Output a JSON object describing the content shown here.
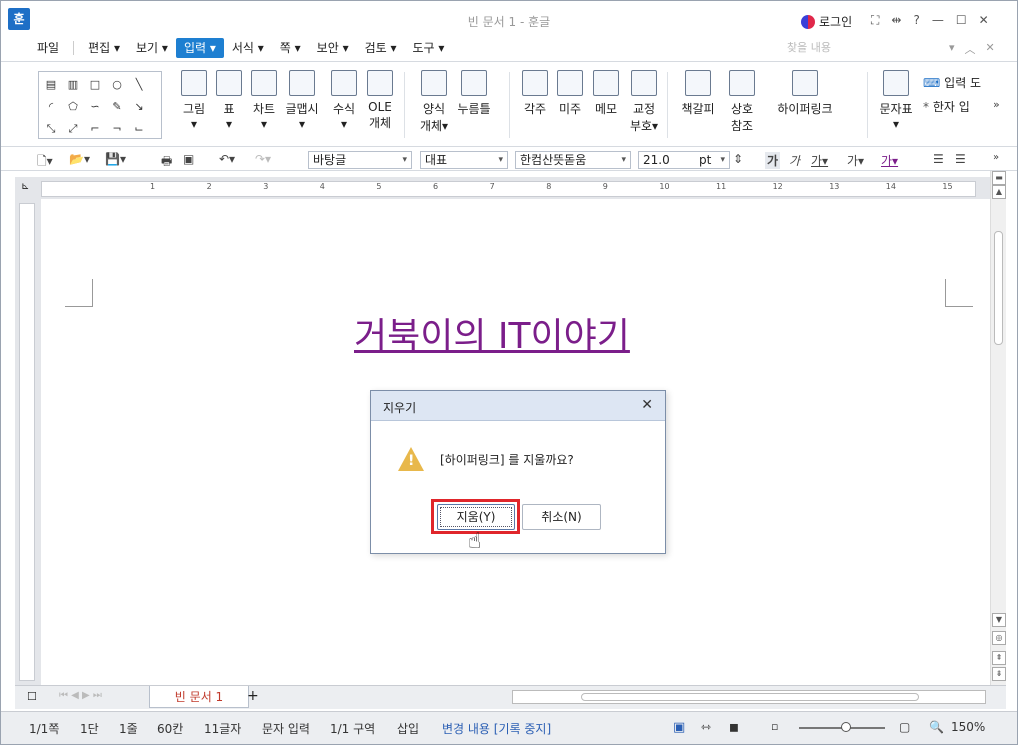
{
  "window": {
    "app_icon": "훈",
    "title": "빈 문서 1 - 훈글",
    "login": "로그인",
    "title_icons": [
      "fullscreen-icon",
      "resize-icon",
      "help-icon",
      "minimize-icon",
      "maximize-icon",
      "close-icon"
    ],
    "title_icon_glyphs": [
      "⛶",
      "⇹",
      "?",
      "—",
      "☐",
      "✕"
    ]
  },
  "menu": {
    "items": [
      {
        "label": "파일",
        "active": false
      },
      {
        "label": "편집 ▾",
        "active": false
      },
      {
        "label": "보기 ▾",
        "active": false
      },
      {
        "label": "입력 ▾",
        "active": true
      },
      {
        "label": "서식 ▾",
        "active": false
      },
      {
        "label": "쪽 ▾",
        "active": false
      },
      {
        "label": "보안 ▾",
        "active": false
      },
      {
        "label": "검토 ▾",
        "active": false
      },
      {
        "label": "도구 ▾",
        "active": false
      }
    ],
    "find_placeholder": "찾을 내용"
  },
  "ribbon": {
    "buttons": [
      {
        "label": "그림",
        "sub": "▾"
      },
      {
        "label": "표",
        "sub": "▾"
      },
      {
        "label": "차트",
        "sub": "▾"
      },
      {
        "label": "글맵시",
        "sub": "▾"
      },
      {
        "label": "수식",
        "sub": "▾"
      },
      {
        "label": "OLE",
        "sub": "개체"
      },
      {
        "label": "양식",
        "sub": "개체▾"
      },
      {
        "label": "누름틀",
        "sub": ""
      },
      {
        "label": "각주",
        "sub": ""
      },
      {
        "label": "미주",
        "sub": ""
      },
      {
        "label": "메모",
        "sub": ""
      },
      {
        "label": "교정",
        "sub": "부호▾"
      },
      {
        "label": "책갈피",
        "sub": ""
      },
      {
        "label": "상호",
        "sub": "참조"
      },
      {
        "label": "하이퍼링크",
        "sub": ""
      },
      {
        "label": "문자표",
        "sub": "▾"
      }
    ],
    "right": {
      "input": "입력 도",
      "hanja": "한자 입"
    }
  },
  "toolbar2": {
    "style": "바탕글",
    "group": "대표",
    "font": "한컴산뜻돋움",
    "size": "21.0",
    "unit": "pt"
  },
  "ruler": {
    "ticks": [
      "1",
      "2",
      "3",
      "4",
      "5",
      "6",
      "7",
      "8",
      "9",
      "10",
      "11",
      "12",
      "13",
      "14",
      "15"
    ]
  },
  "document": {
    "title": "거북이의 IT이야기"
  },
  "dialog": {
    "title": "지우기",
    "message": "[하이퍼링크] 를 지울까요?",
    "ok": "지움(Y)",
    "cancel": "취소(N)"
  },
  "tabs": {
    "doc_tab": "빈 문서 1",
    "add": "+"
  },
  "status": {
    "page": "1/1쪽",
    "column": "1단",
    "line": "1줄",
    "col": "60칸",
    "chars": "11글자",
    "mode": "문자 입력",
    "section": "1/1 구역",
    "insert": "삽입",
    "track": "변경 내용 [기록 중지]",
    "zoom": "150%"
  }
}
